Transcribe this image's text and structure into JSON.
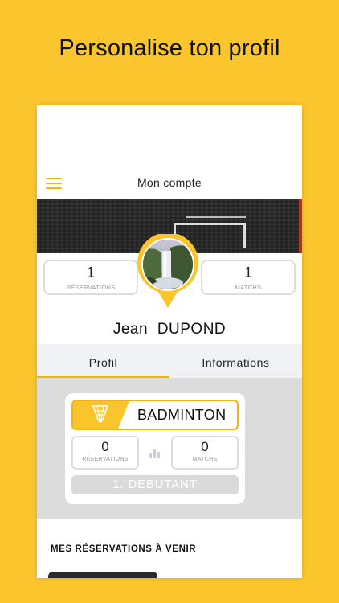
{
  "headline": "Personalise ton profil",
  "topbar": {
    "title": "Mon compte"
  },
  "stats": {
    "reservations": {
      "value": "1",
      "label": "RÉSERVATIONS"
    },
    "matchs": {
      "value": "1",
      "label": "MATCHS"
    }
  },
  "user": {
    "first_name": "Jean",
    "last_name": "DUPOND"
  },
  "tabs": [
    {
      "label": "Profil",
      "active": true
    },
    {
      "label": "Informations",
      "active": false
    }
  ],
  "sport": {
    "name": "BADMINTON",
    "icon": "shuttlecock-icon",
    "reservations": {
      "value": "0",
      "label": "RÉSERVATIONS"
    },
    "matchs": {
      "value": "0",
      "label": "MATCHS"
    },
    "level": "1. DÉBUTANT"
  },
  "reservations_section": {
    "title": "MES RÉSERVATIONS À VENIR"
  },
  "colors": {
    "background": "#FBC52D",
    "accent": "#F2B319",
    "muted": "#DADADA"
  }
}
